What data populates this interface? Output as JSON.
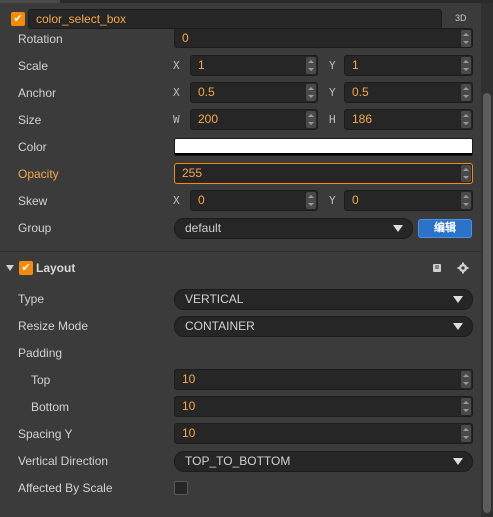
{
  "node": {
    "enabled": true,
    "name": "color_select_box",
    "tag": "3D"
  },
  "properties": {
    "rotation": {
      "label": "Rotation",
      "value": "0"
    },
    "scale": {
      "label": "Scale",
      "x_axis": "X",
      "x": "1",
      "y_axis": "Y",
      "y": "1"
    },
    "anchor": {
      "label": "Anchor",
      "x_axis": "X",
      "x": "0.5",
      "y_axis": "Y",
      "y": "0.5"
    },
    "size": {
      "label": "Size",
      "w_axis": "W",
      "w": "200",
      "h_axis": "H",
      "h": "186"
    },
    "color": {
      "label": "Color",
      "hex": "#ffffff"
    },
    "opacity": {
      "label": "Opacity",
      "value": "255"
    },
    "skew": {
      "label": "Skew",
      "x_axis": "X",
      "x": "0",
      "y_axis": "Y",
      "y": "0"
    },
    "group": {
      "label": "Group",
      "value": "default",
      "edit_label": "编辑"
    }
  },
  "layout": {
    "title": "Layout",
    "enabled": true,
    "type": {
      "label": "Type",
      "value": "VERTICAL"
    },
    "resize_mode": {
      "label": "Resize Mode",
      "value": "CONTAINER"
    },
    "padding": {
      "label": "Padding"
    },
    "top": {
      "label": "Top",
      "value": "10"
    },
    "bottom": {
      "label": "Bottom",
      "value": "10"
    },
    "spacing_y": {
      "label": "Spacing Y",
      "value": "10"
    },
    "vertical_direction": {
      "label": "Vertical Direction",
      "value": "TOP_TO_BOTTOM"
    },
    "affected_by_scale": {
      "label": "Affected By Scale",
      "checked": false
    }
  },
  "colors": {
    "accent": "#f58a0b",
    "value_text": "#f5a94a",
    "button_blue": "#2a73c9",
    "panel_bg": "#3b3b3b",
    "field_bg": "#262626"
  },
  "icons": {
    "check": "✔",
    "help": "book-icon",
    "settings": "gear-icon",
    "collapse": "triangle-down-icon"
  }
}
